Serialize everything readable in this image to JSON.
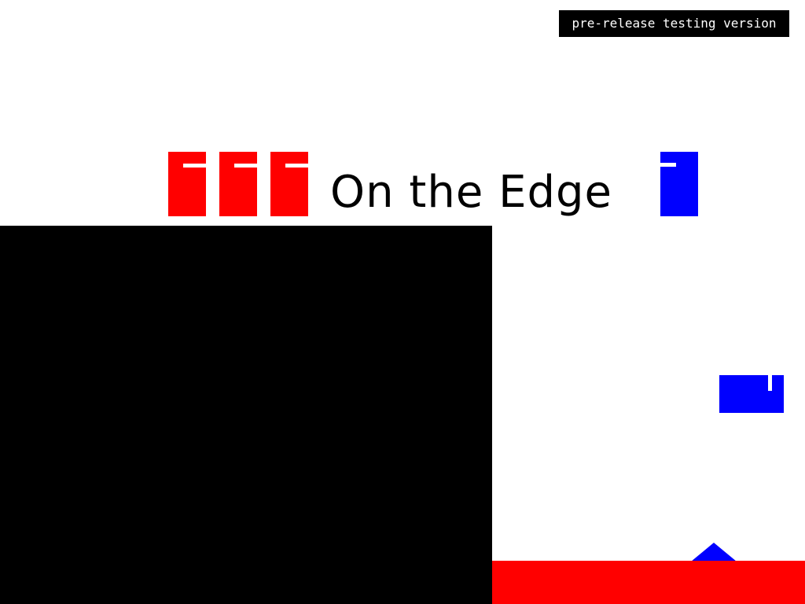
{
  "colors": {
    "red": "#ff0000",
    "blue": "#0000ff",
    "black": "#000000",
    "background": "#ffffff"
  },
  "build_badge": "pre-release testing version",
  "game_title": "On the Edge",
  "hud": {
    "red_blocks_count": 3,
    "blue_blocks_count": 1
  },
  "scene": {
    "platform": "black-wall",
    "floor": "red-floor",
    "player": "blue-block",
    "hazard": "blue-spike"
  }
}
